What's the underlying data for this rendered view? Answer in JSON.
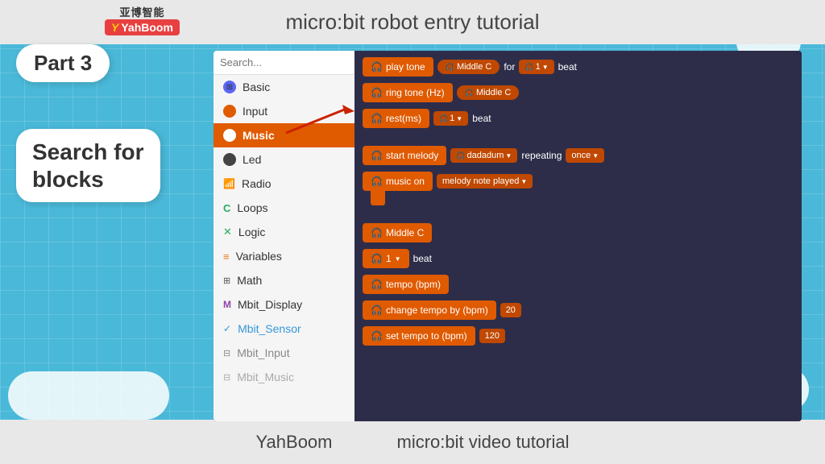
{
  "header": {
    "logo_top": "亚博智能",
    "logo_brand": "YahBoom",
    "title": "micro:bit robot entry tutorial"
  },
  "footer": {
    "brand": "YahBoom",
    "subtitle": "micro:bit video tutorial"
  },
  "sidebar_label": {
    "part": "Part 3",
    "search_bubble": "Search for\nblocks",
    "search_placeholder": "Search..."
  },
  "sidebar": {
    "items": [
      {
        "id": "basic",
        "label": "Basic",
        "icon": "⊞",
        "dot": "dot-basic"
      },
      {
        "id": "input",
        "label": "Input",
        "icon": "◉",
        "dot": "dot-input"
      },
      {
        "id": "music",
        "label": "Music",
        "icon": "◉",
        "dot": "dot-music",
        "active": true
      },
      {
        "id": "led",
        "label": "Led",
        "icon": "◉",
        "dot": "dot-led"
      },
      {
        "id": "radio",
        "label": "Radio",
        "icon": "◉",
        "dot": "dot-radio"
      },
      {
        "id": "loops",
        "label": "Loops",
        "icon": "C",
        "dot": "dot-loops"
      },
      {
        "id": "logic",
        "label": "Logic",
        "icon": "✕",
        "dot": "dot-logic"
      },
      {
        "id": "variables",
        "label": "Variables",
        "icon": "≡",
        "dot": "dot-variables"
      },
      {
        "id": "math",
        "label": "Math",
        "icon": "⊞",
        "dot": "dot-math"
      },
      {
        "id": "mbit-display",
        "label": "Mbit_Display",
        "icon": "M",
        "dot": "dot-mbit-display"
      },
      {
        "id": "mbit-sensor",
        "label": "Mbit_Sensor",
        "icon": "✓",
        "dot": "dot-mbit-sensor"
      },
      {
        "id": "mbit-input",
        "label": "Mbit_Input",
        "icon": "⊟",
        "dot": "dot-mbit-input"
      },
      {
        "id": "mbit-music",
        "label": "Mbit_Music",
        "icon": "⊟",
        "dot": "dot-mbit-music"
      }
    ]
  },
  "blocks": {
    "play_tone": "play tone",
    "middle_c_1": "Middle C",
    "for_text": "for",
    "beat_1": "beat",
    "ring_tone": "ring tone (Hz)",
    "middle_c_2": "Middle C",
    "rest_ms": "rest(ms)",
    "beat_2": "beat",
    "start_melody": "start melody",
    "dadadum": "dadadum",
    "repeating": "repeating",
    "once": "once",
    "music_on": "music on",
    "melody_note": "melody note played",
    "middle_c_3": "Middle C",
    "one_beat": "1",
    "beat_3": "beat",
    "tempo_bpm": "tempo (bpm)",
    "change_tempo": "change tempo by (bpm)",
    "val_20": "20",
    "set_tempo": "set tempo to (bpm)",
    "val_120": "120"
  }
}
